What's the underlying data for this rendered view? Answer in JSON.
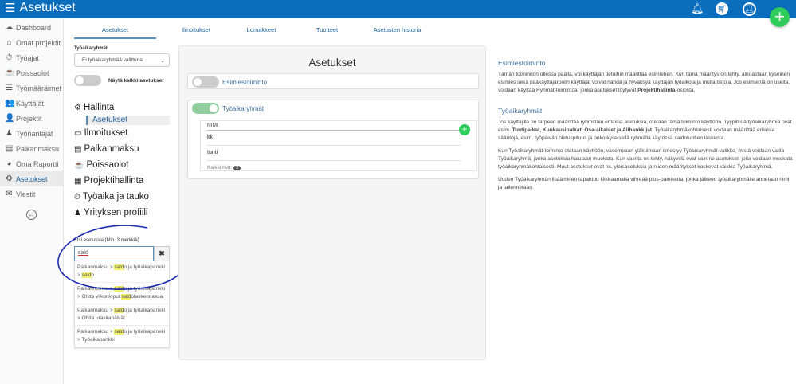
{
  "header": {
    "title": "Asetukset"
  },
  "sidebar": {
    "items": [
      {
        "label": "Dashboard",
        "icon": "☁"
      },
      {
        "label": "Omat projektit",
        "icon": "⌂"
      },
      {
        "label": "Työajat",
        "icon": "⏱"
      },
      {
        "label": "Poissaolot",
        "icon": "☕"
      },
      {
        "label": "Työmääräimet",
        "icon": "☰"
      },
      {
        "label": "Käyttäjät",
        "icon": "👥"
      },
      {
        "label": "Projektit",
        "icon": "👤"
      },
      {
        "label": "Työnantajat",
        "icon": "♟"
      },
      {
        "label": "Palkanmaksu",
        "icon": "▤"
      },
      {
        "label": "Oma Raportti",
        "icon": "◕"
      },
      {
        "label": "Asetukset",
        "icon": "⚙"
      },
      {
        "label": "Viestit",
        "icon": "✉"
      }
    ],
    "collapse_icon": "←"
  },
  "tabs": [
    "Asetukset",
    "Ilmoitukset",
    "Lomakkeet",
    "Tuotteet",
    "Asetusten historia"
  ],
  "settings": {
    "group_label": "Työaikaryhmät",
    "group_value": "Ei työaikaryhmää valittuna",
    "show_all": "Näytä kaikki asetukset",
    "categories": [
      {
        "label": "Hallinta",
        "icon": "⚙"
      },
      {
        "label": "Ilmoitukset",
        "icon": "▭"
      },
      {
        "label": "Palkanmaksu",
        "icon": "▤"
      },
      {
        "label": "Poissaolot",
        "icon": "☕"
      },
      {
        "label": "Projektihallinta",
        "icon": "▦"
      },
      {
        "label": "Työaika ja tauko",
        "icon": "⏱"
      },
      {
        "label": "Yrityksen profiili",
        "icon": "♟"
      }
    ],
    "sub": "Asetukset"
  },
  "search": {
    "label": "Etsi asetuksia (Min. 3 merkkiä)",
    "value": "sald",
    "clear": "✖",
    "results": [
      [
        "Palkanmaksu > ",
        "sald",
        "o ja työaikapankki > ",
        "sald",
        "o"
      ],
      [
        "Palkanmaksu > ",
        "sald",
        "o ja työaikapankki > Ohita viikonloput ",
        "sald",
        "olaskennassa"
      ],
      [
        "Palkanmaksu > ",
        "sald",
        "o ja työaikapankki > Ohita urakkapäivät",
        "",
        ""
      ],
      [
        "Palkanmaksu > ",
        "sald",
        "o ja työaikapankki > Työaikapankki",
        "",
        ""
      ]
    ]
  },
  "panel": {
    "title": "Asetukset",
    "esimies": "Esimiestoiminto",
    "tyoaika": "Työaikaryhmät",
    "col": "NIMI",
    "rows": [
      "kk",
      "tunti"
    ],
    "footer": "Kaikki rivit:",
    "count": "2",
    "add": "+"
  },
  "help": {
    "h1": "Esimiestoiminto",
    "p1a": "Tämän toiminnon ollessa päällä, voi käyttäjän tietoihin määrittää esimiehen. Kun tämä määritys on tehty, ainoastaan kyseinen esimies sekä pääkäyttäjäroolin käyttäjät voivat nähdä ja hyväksyä käyttäjän työaikoja ja muita tietoja. Jos esimiehiä on useita, voidaan käyttää Ryhmät-toimintoa, jonka asetukset löytyvät ",
    "p1b": "Projektihallinta",
    "p1c": "-osiosta.",
    "h2": "Työaikaryhmät",
    "p2a": "Jos käyttäjille on tarpeen määrittää ryhmittäin erilaisia asetuksia, otetaan tämä toiminto käyttöön. Tyypillisiä työaikaryhmiä ovat esim. ",
    "p2b": "Tuntipalkat, Kuukausipalkat, Osa-aikaiset ja Alihankkijat",
    "p2c": ". Työaikaryhmäkohtaisesti voidaan määrittää erilaisia sääntöjä, esim. työpäivän oletuspituus ja onko kyseisellä ryhmällä käytössä saldotuntien laskenta.",
    "p3": "Kun Työaikaryhmät-toiminto otetaan käyttöön, vasempaan yläkulmaan ilmestyy Työaikaryhmät-valikko, mistä voidaan valita Työaikaryhmä, jonka asetuksia halutaan muokata. Kun valinta on tehty, näkyvillä ovat vain ne asetukset, joita voidaan muokata työaikaryhmäkohtaisesti. Muut asetukset ovat ns. yleisasetuksia ja niiden määritykset koskevat kaikkia Työaikaryhmiä.",
    "p4": "Uuden Työaikaryhmän lisääminen tapahtuu klikkaamalla vihreää plus-painiketta, jonka jälkeen työaikaryhmälle annetaan nimi ja tallennetaan."
  },
  "colors": {
    "header": "#0a6ebd",
    "accent": "#2ecc5a",
    "link": "#3f6f9a"
  }
}
